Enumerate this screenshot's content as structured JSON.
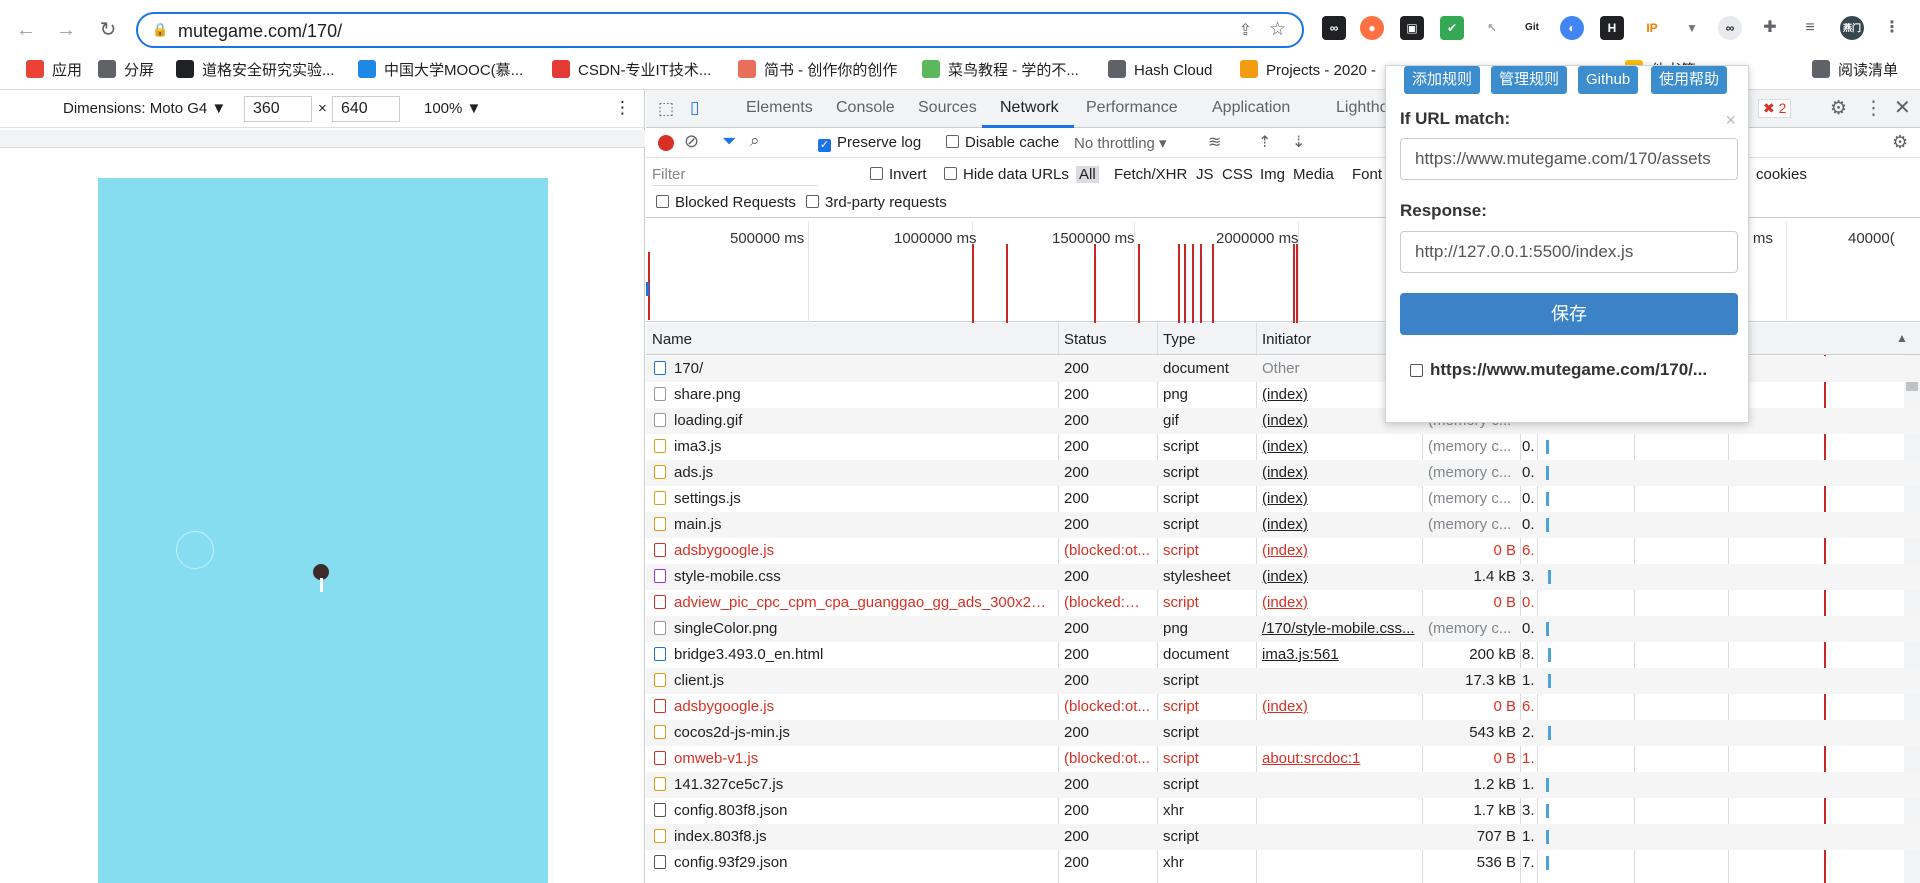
{
  "browser": {
    "url": "mutegame.com/170/",
    "avatar_label": "燕门"
  },
  "bookmarks": [
    {
      "label": "应用",
      "color": "#ea4335"
    },
    {
      "label": "分屏",
      "color": "#5f6368"
    },
    {
      "label": "道格安全研究实验...",
      "color": "#202124"
    },
    {
      "label": "中国大学MOOC(慕...",
      "color": "#1e88e5"
    },
    {
      "label": "CSDN-专业IT技术...",
      "color": "#e53935"
    },
    {
      "label": "简书 - 创作你的创作",
      "color": "#ea6f5a"
    },
    {
      "label": "菜鸟教程 - 学的不...",
      "color": "#5cb85c"
    },
    {
      "label": "Hash Cloud",
      "color": "#5f6368"
    },
    {
      "label": "Projects - 2020 -",
      "color": "#f39c12"
    },
    {
      "label": "他书签",
      "color": "#fbbc04"
    },
    {
      "label": "阅读清单",
      "color": "#5f6368"
    }
  ],
  "device_toolbar": {
    "dimensions_label": "Dimensions: Moto G4 ▼",
    "width": "360",
    "times": "×",
    "height": "640",
    "zoom": "100% ▼"
  },
  "devtools": {
    "tabs": [
      "Elements",
      "Console",
      "Sources",
      "Network",
      "Performance",
      "Application",
      "Lighthouse"
    ],
    "active_tab": "Network",
    "error_count": "2",
    "preserve_log": "Preserve log",
    "disable_cache": "Disable cache",
    "throttling": "No throttling",
    "filter_placeholder": "Filter",
    "invert": "Invert",
    "hide_data_urls": "Hide data URLs",
    "filter_types": [
      "All",
      "Fetch/XHR",
      "JS",
      "CSS",
      "Img",
      "Media",
      "Font"
    ],
    "cookies": "cookies",
    "blocked_requests": "Blocked Requests",
    "third_party": "3rd-party requests",
    "overview_labels": [
      "500000 ms",
      "1000000 ms",
      "1500000 ms",
      "2000000 ms",
      "2",
      "00 ms",
      "40000("
    ],
    "columns": [
      "Name",
      "Status",
      "Type",
      "Initiator"
    ]
  },
  "requests": [
    {
      "name": "170/",
      "status": "200",
      "type": "document",
      "initiator": "Other",
      "size": "",
      "time": "",
      "kind": "doc",
      "error": false,
      "link": false
    },
    {
      "name": "share.png",
      "status": "200",
      "type": "png",
      "initiator": "(index)",
      "size": "",
      "time": "",
      "kind": "img",
      "error": false,
      "link": true
    },
    {
      "name": "loading.gif",
      "status": "200",
      "type": "gif",
      "initiator": "(index)",
      "size": "(memory c...",
      "time": "",
      "kind": "img",
      "error": false,
      "link": true
    },
    {
      "name": "ima3.js",
      "status": "200",
      "type": "script",
      "initiator": "(index)",
      "size": "(memory c...",
      "time": "0.",
      "kind": "js",
      "error": false,
      "link": true
    },
    {
      "name": "ads.js",
      "status": "200",
      "type": "script",
      "initiator": "(index)",
      "size": "(memory c...",
      "time": "0.",
      "kind": "js",
      "error": false,
      "link": true
    },
    {
      "name": "settings.js",
      "status": "200",
      "type": "script",
      "initiator": "(index)",
      "size": "(memory c...",
      "time": "0.",
      "kind": "js",
      "error": false,
      "link": true
    },
    {
      "name": "main.js",
      "status": "200",
      "type": "script",
      "initiator": "(index)",
      "size": "(memory c...",
      "time": "0.",
      "kind": "js",
      "error": false,
      "link": true
    },
    {
      "name": "adsbygoogle.js",
      "status": "(blocked:ot...",
      "type": "script",
      "initiator": "(index)",
      "size": "0 B",
      "time": "6.",
      "kind": "err",
      "error": true,
      "link": true
    },
    {
      "name": "style-mobile.css",
      "status": "200",
      "type": "stylesheet",
      "initiator": "(index)",
      "size": "1.4 kB",
      "time": "3.",
      "kind": "css",
      "error": false,
      "link": true
    },
    {
      "name": "adview_pic_cpc_cpm_cpa_guanggao_gg_ads_300x250.js",
      "status": "(blocked:mi...",
      "type": "script",
      "initiator": "(index)",
      "size": "0 B",
      "time": "0.",
      "kind": "err",
      "error": true,
      "link": true
    },
    {
      "name": "singleColor.png",
      "status": "200",
      "type": "png",
      "initiator": "/170/style-mobile.css...",
      "size": "(memory c...",
      "time": "0.",
      "kind": "img",
      "error": false,
      "link": true
    },
    {
      "name": "bridge3.493.0_en.html",
      "status": "200",
      "type": "document",
      "initiator": "ima3.js:561",
      "size": "200 kB",
      "time": "8.",
      "kind": "doc",
      "error": false,
      "link": true
    },
    {
      "name": "client.js",
      "status": "200",
      "type": "script",
      "initiator": "",
      "size": "17.3 kB",
      "time": "1.",
      "kind": "js",
      "error": false,
      "link": false
    },
    {
      "name": "adsbygoogle.js",
      "status": "(blocked:ot...",
      "type": "script",
      "initiator": "(index)",
      "size": "0 B",
      "time": "6.",
      "kind": "err",
      "error": true,
      "link": true
    },
    {
      "name": "cocos2d-js-min.js",
      "status": "200",
      "type": "script",
      "initiator": "",
      "size": "543 kB",
      "time": "2.",
      "kind": "js",
      "error": false,
      "link": false
    },
    {
      "name": "omweb-v1.js",
      "status": "(blocked:ot...",
      "type": "script",
      "initiator": "about:srcdoc:1",
      "size": "0 B",
      "time": "1.",
      "kind": "err",
      "error": true,
      "link": true
    },
    {
      "name": "141.327ce5c7.js",
      "status": "200",
      "type": "script",
      "initiator": "",
      "size": "1.2 kB",
      "time": "1.",
      "kind": "js",
      "error": false,
      "link": false
    },
    {
      "name": "config.803f8.json",
      "status": "200",
      "type": "xhr",
      "initiator": "",
      "size": "1.7 kB",
      "time": "3.",
      "kind": "json",
      "error": false,
      "link": false
    },
    {
      "name": "index.803f8.js",
      "status": "200",
      "type": "script",
      "initiator": "",
      "size": "707 B",
      "time": "1.",
      "kind": "js",
      "error": false,
      "link": false
    },
    {
      "name": "config.93f29.json",
      "status": "200",
      "type": "xhr",
      "initiator": "",
      "size": "536 B",
      "time": "7.",
      "kind": "json",
      "error": false,
      "link": false
    }
  ],
  "popup": {
    "buttons": [
      "添加规则",
      "管理规则",
      "Github",
      "使用帮助"
    ],
    "url_match_label": "If URL match:",
    "url_match_value": "https://www.mutegame.com/170/assets",
    "response_label": "Response:",
    "response_value": "http://127.0.0.1:5500/index.js",
    "save_label": "保存",
    "rule_item": "https://www.mutegame.com/170/...",
    "close": "×"
  }
}
